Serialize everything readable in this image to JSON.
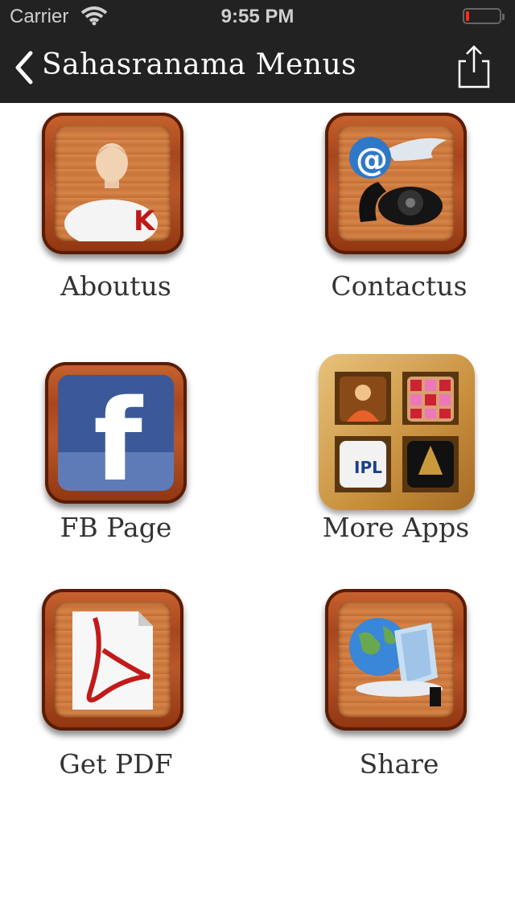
{
  "status_bar": {
    "carrier": "Carrier",
    "time": "9:55 PM"
  },
  "nav": {
    "title": "Sahasranama  Menus"
  },
  "menu": {
    "aboutus": "Aboutus",
    "contactus": "Contactus",
    "fbpage": "FB Page",
    "moreapps": "More Apps",
    "getpdf": "Get PDF",
    "share": "Share"
  },
  "icon_text": {
    "k": "K",
    "at": "@",
    "f": "f",
    "ipl": "IPL"
  },
  "colors": {
    "bar": "#222222",
    "wood": "#b9572a",
    "battery_low": "#ff2a1a"
  }
}
